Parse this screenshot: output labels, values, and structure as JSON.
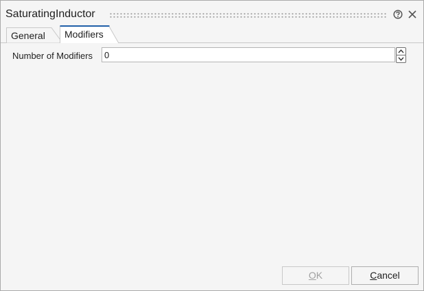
{
  "window": {
    "title": "SaturatingInductor",
    "help_icon": "help-circle-icon",
    "close_icon": "close-icon"
  },
  "tabs": [
    {
      "label": "General",
      "selected": false
    },
    {
      "label": "Modifiers",
      "selected": true
    }
  ],
  "form": {
    "number_of_modifiers_label": "Number of Modifiers",
    "number_of_modifiers_value": "0"
  },
  "buttons": {
    "ok": {
      "mnemonic": "O",
      "rest": "K",
      "enabled": false
    },
    "cancel": {
      "mnemonic": "C",
      "rest": "ancel",
      "enabled": true
    }
  },
  "colors": {
    "dialog_background": "#f5f5f5",
    "selected_tab_accent": "#1f5fa8",
    "disabled_text": "#a0a0a0"
  }
}
